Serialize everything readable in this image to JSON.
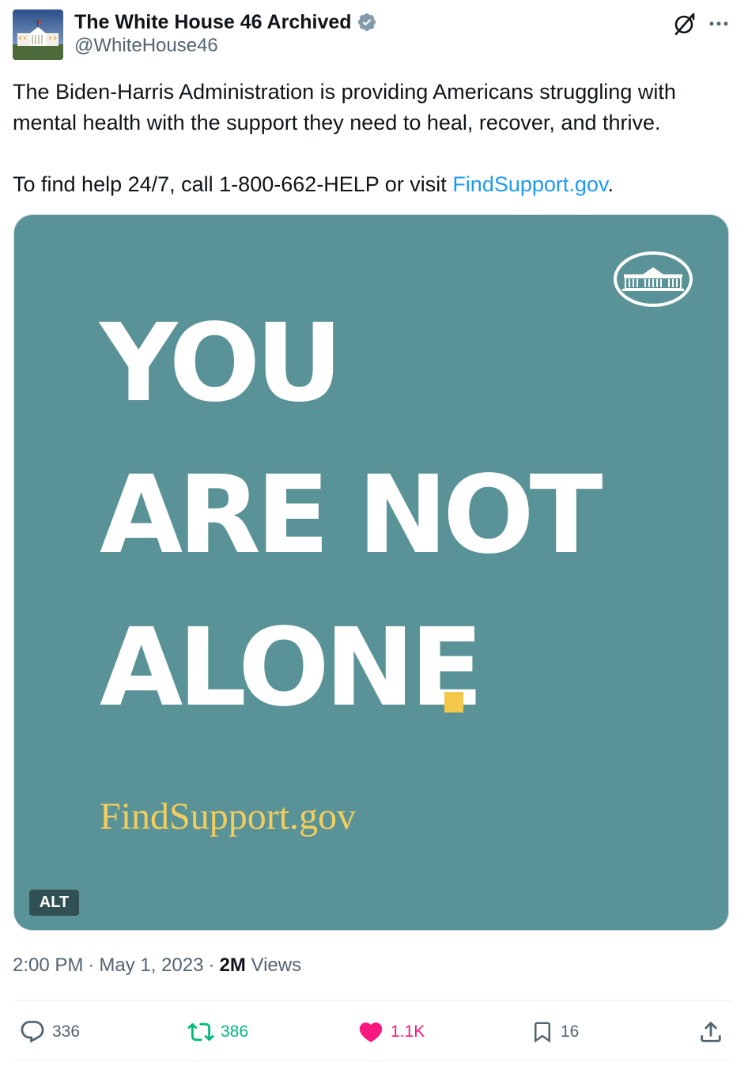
{
  "author": {
    "display_name": "The White House 46 Archived",
    "handle": "@WhiteHouse46",
    "verified": true,
    "badge_color": "#829aab"
  },
  "header_icons": [
    "grok-icon",
    "more-icon"
  ],
  "tweet": {
    "text_line_1": "The Biden-Harris Administration is providing Americans struggling with mental health with the support they need to heal, recover, and thrive.",
    "text_line_2_prefix": "To find help 24/7, call 1-800-662-HELP or visit ",
    "link_text": "FindSupport.gov",
    "text_line_2_suffix": ".",
    "link_color": "#1d9bf0"
  },
  "media": {
    "background_color": "#5a9397",
    "headline_line_1": "YOU",
    "headline_line_2": "ARE NOT",
    "headline_line_3": "ALONE",
    "accent_color": "#f2c94c",
    "url_text": "FindSupport.gov",
    "alt_badge": "ALT"
  },
  "meta": {
    "time": "2:00 PM",
    "separator": "·",
    "date": "May 1, 2023",
    "views_count": "2M",
    "views_label": "Views"
  },
  "actions": {
    "replies": "336",
    "retweets": "386",
    "likes": "1.1K",
    "bookmarks": "16",
    "retweet_color": "#00ba7c",
    "like_color": "#f91880"
  }
}
